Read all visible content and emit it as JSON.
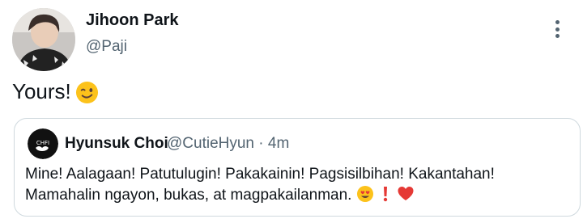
{
  "tweet": {
    "author_name": "Jihoon Park",
    "author_handle": "@Paji",
    "text": "Yours!",
    "emoji": "wink-emoji"
  },
  "quote": {
    "author_name": "Hyunsuk Choi",
    "author_handle": "@CutieHyun",
    "time_separator": "·",
    "time": "4m",
    "line1": "Mine! Aalagaan! Patutulugin! Pakakainin! Pagsisilbihan! Kakantahan!",
    "line2": "Mamahalin ngayon, bukas, at magpakailanman.",
    "emojis": [
      "heart-eyes-emoji",
      "red-exclamation-emoji",
      "red-heart-emoji"
    ]
  },
  "colors": {
    "text": "#0f1419",
    "secondary": "#536471",
    "border": "#cfd9de"
  }
}
